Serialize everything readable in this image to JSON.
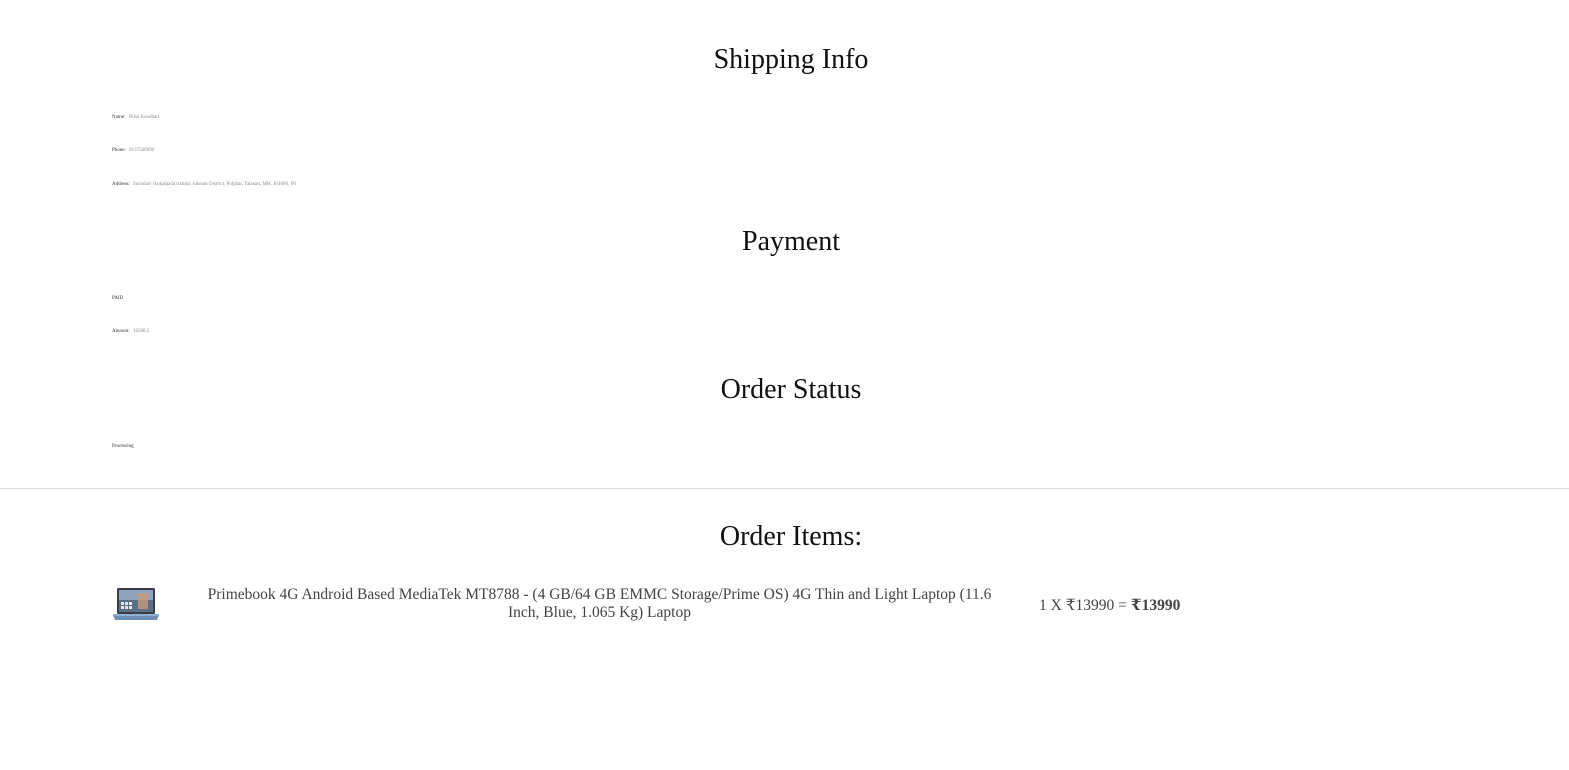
{
  "shipping": {
    "title": "Shipping Info",
    "name_label": "Name:",
    "name_value": "Nilsa Kondhari",
    "phone_label": "Phone:",
    "phone_value": "9137566690",
    "address_label": "Address:",
    "address_value": "Suroshav (kokalpada) talukn, tukeam District, Polghar, Talasari, MH, 401606, IN"
  },
  "payment": {
    "title": "Payment",
    "status": "PAID",
    "amount_label": "Amount:",
    "amount_value": "16508.2"
  },
  "order_status": {
    "title": "Order Status",
    "value": "Processing"
  },
  "order_items": {
    "title": "Order Items:",
    "items": [
      {
        "name": "Primebook 4G Android Based MediaTek MT8788 - (4 GB/64 GB EMMC Storage/Prime OS) 4G Thin and Light Laptop (11.6 Inch, Blue, 1.065 Kg) Laptop",
        "qty_price": "1 X ₹13990 =",
        "total": "₹13990",
        "image_icon": "laptop-image"
      }
    ]
  }
}
